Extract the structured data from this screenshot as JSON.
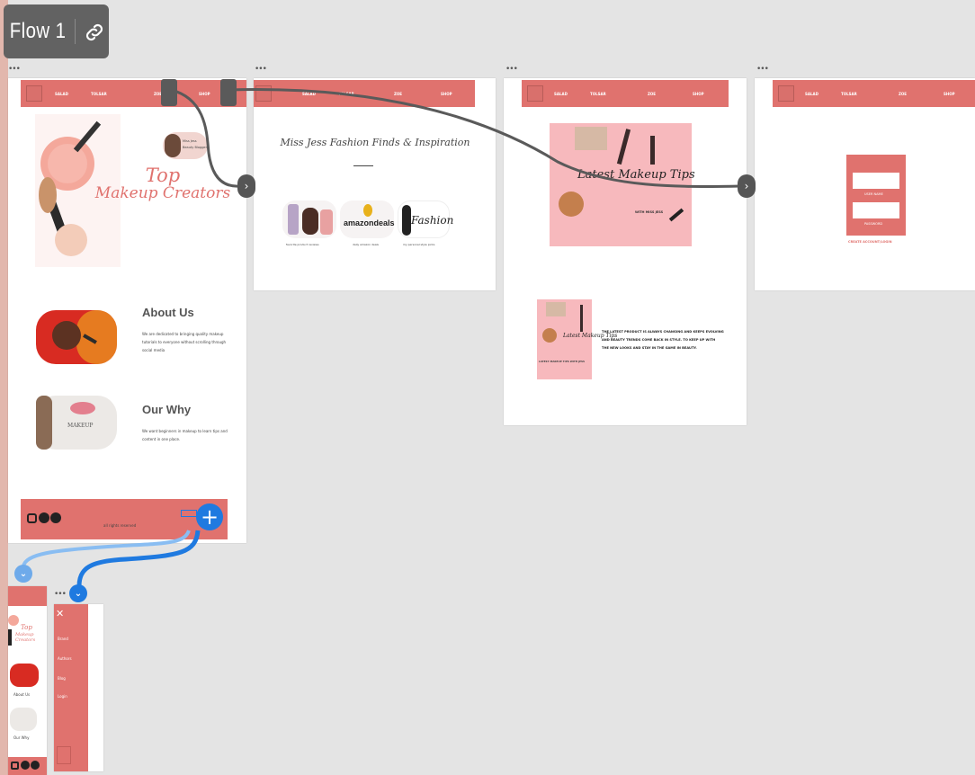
{
  "flow": {
    "label": "Flow 1"
  },
  "artboard_menu_glyph": "•••",
  "colors": {
    "canvas": "#e4e4e4",
    "brand": "#e0726e",
    "connector": "#5a5a5a",
    "interaction": "#1f7ae0"
  },
  "home": {
    "nav": [
      "SALAD",
      "TOLSAR",
      "ZOE",
      "SHOP"
    ],
    "heading_line1": "Top",
    "heading_line2": "Makeup Creators",
    "badge_name": "Miss Jess",
    "badge_sub": "Beauty Blogger",
    "about_title": "About Us",
    "about_text": "We are dedicated to bringing quality makeup tutorials to everyone without scrolling through social media",
    "why_title": "Our Why",
    "why_text": "We want beginners in makeup to learn tips and content in one place.",
    "footer_text": "all rights reserved",
    "makeup_text": "MAKEUP"
  },
  "inspiration": {
    "nav": [
      "SALAD",
      "TOLSAR",
      "ZOE",
      "SHOP"
    ],
    "title": "Miss Jess Fashion Finds & Inspiration",
    "cards": [
      {
        "label": "",
        "caption": "favorite product reviews"
      },
      {
        "label": "amazondeals",
        "caption": "daily amazon deals"
      },
      {
        "label": "Fashion",
        "caption": "my personal style picks"
      }
    ]
  },
  "tips": {
    "nav": [
      "SALAD",
      "TOLSAR",
      "ZOE",
      "SHOP"
    ],
    "hero_title": "Latest Makeup Tips",
    "hero_sub": "WITH MISS JESS",
    "thumb_title": "Latest Makeup Tips",
    "thumb_caption": "LATEST MAKEUP TIPS WITH JESS",
    "body_lines": [
      "THE LATEST PRODUCT IS ALWAYS CHANGING AND KEEPS EVOLVING",
      "AND BEAUTY TRENDS COME BACK IN STYLE. TO KEEP UP WITH",
      "THE NEW LOOKS AND STAY IN THE GAME IN BEAUTY."
    ]
  },
  "login": {
    "nav": [
      "SALAD",
      "TOLSAR",
      "ZOE",
      "SHOP"
    ],
    "field1_label": "USER NAME",
    "field2_label": "PASSWORD",
    "link": "CREATE ACCOUNT/LOGIN"
  },
  "mobile": {
    "heading_line1": "Top",
    "heading_line2": "Makeup Creators",
    "about": "About Us",
    "why": "Our Why"
  },
  "menu_overlay": {
    "close": "✕",
    "items": [
      "Brand",
      "Authors",
      "Blog",
      "Login"
    ]
  }
}
